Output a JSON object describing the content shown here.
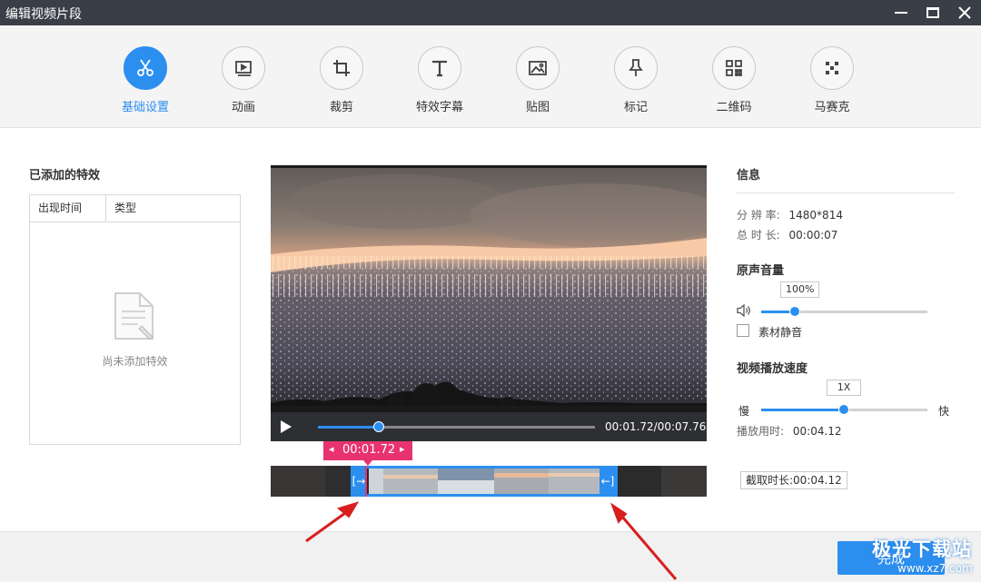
{
  "window": {
    "title": "编辑视频片段"
  },
  "toolbar": {
    "items": [
      {
        "label": "基础设置",
        "icon": "scissors-icon",
        "active": true
      },
      {
        "label": "动画",
        "icon": "play-frame-icon"
      },
      {
        "label": "裁剪",
        "icon": "crop-icon"
      },
      {
        "label": "特效字幕",
        "icon": "text-icon"
      },
      {
        "label": "贴图",
        "icon": "image-icon"
      },
      {
        "label": "标记",
        "icon": "pin-icon"
      },
      {
        "label": "二维码",
        "icon": "qrcode-icon"
      },
      {
        "label": "马赛克",
        "icon": "mosaic-icon"
      }
    ]
  },
  "effects": {
    "heading": "已添加的特效",
    "columns": [
      "出现时间",
      "类型"
    ],
    "empty_text": "尚未添加特效"
  },
  "player": {
    "time": "00:01.72/00:07.76",
    "progress": 0.221
  },
  "trim": {
    "current_time": "00:01.72",
    "clip_length": "截取时长:00:04.12"
  },
  "info": {
    "heading": "信息",
    "resolution_label": "分 辨 率:",
    "resolution": "1480*814",
    "duration_label": "总 时 长:",
    "duration": "00:00:07"
  },
  "volume": {
    "heading": "原声音量",
    "value": "100%",
    "level": 0.2,
    "mute_label": "素材静音"
  },
  "speed": {
    "heading": "视频播放速度",
    "value": "1X",
    "slow": "慢",
    "fast": "快",
    "time_label": "播放用时:",
    "time": "00:04.12"
  },
  "footer": {
    "done": "完成"
  },
  "watermark": {
    "text": "极光下载站",
    "url": "www.xz7.com"
  },
  "colors": {
    "accent": "#2c8ff0",
    "marker": "#e8336f",
    "arrow": "#d81e1e"
  }
}
